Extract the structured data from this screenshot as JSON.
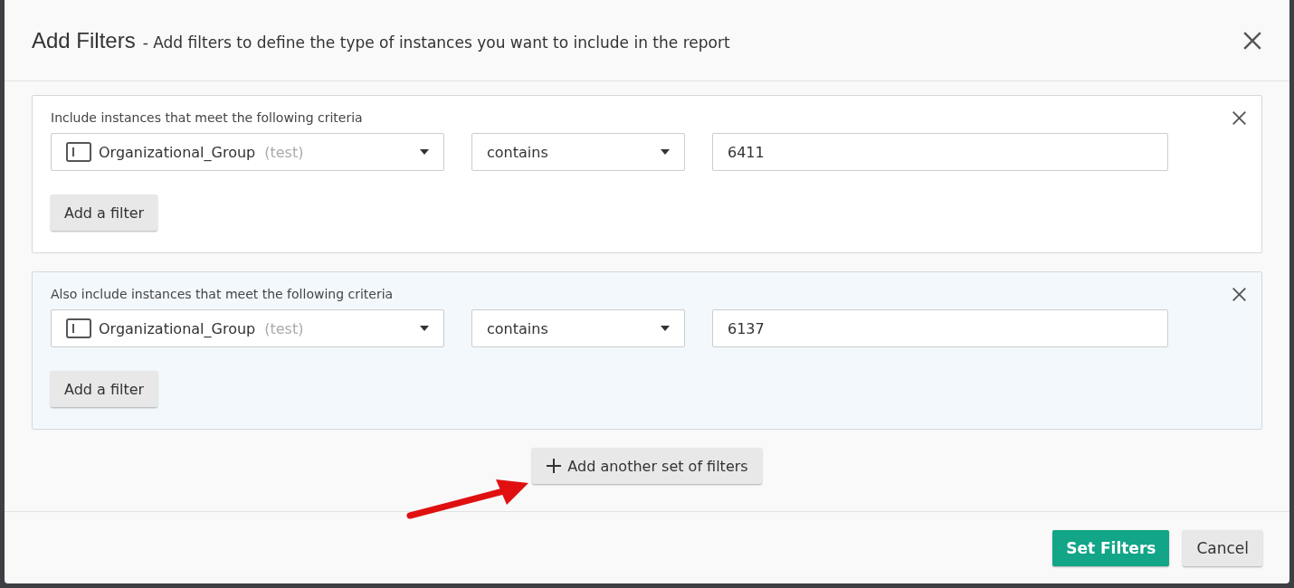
{
  "dialog": {
    "title": "Add Filters",
    "subtitle": "- Add filters to define the type of instances you want to include in the report"
  },
  "filter_sets": [
    {
      "label": "Include instances that meet the following criteria",
      "highlighted": false,
      "filters": [
        {
          "field": "Organizational_Group",
          "field_note": "(test)",
          "operator": "contains",
          "value": "6411"
        }
      ],
      "add_button": "Add a filter"
    },
    {
      "label": "Also include instances that meet the following criteria",
      "highlighted": true,
      "filters": [
        {
          "field": "Organizational_Group",
          "field_note": "(test)",
          "operator": "contains",
          "value": "6137"
        }
      ],
      "add_button": "Add a filter"
    }
  ],
  "add_set_button": "Add another set of filters",
  "footer_buttons": [
    {
      "label": "Set Filters",
      "kind": "primary"
    },
    {
      "label": "Cancel",
      "kind": "secondary"
    }
  ]
}
